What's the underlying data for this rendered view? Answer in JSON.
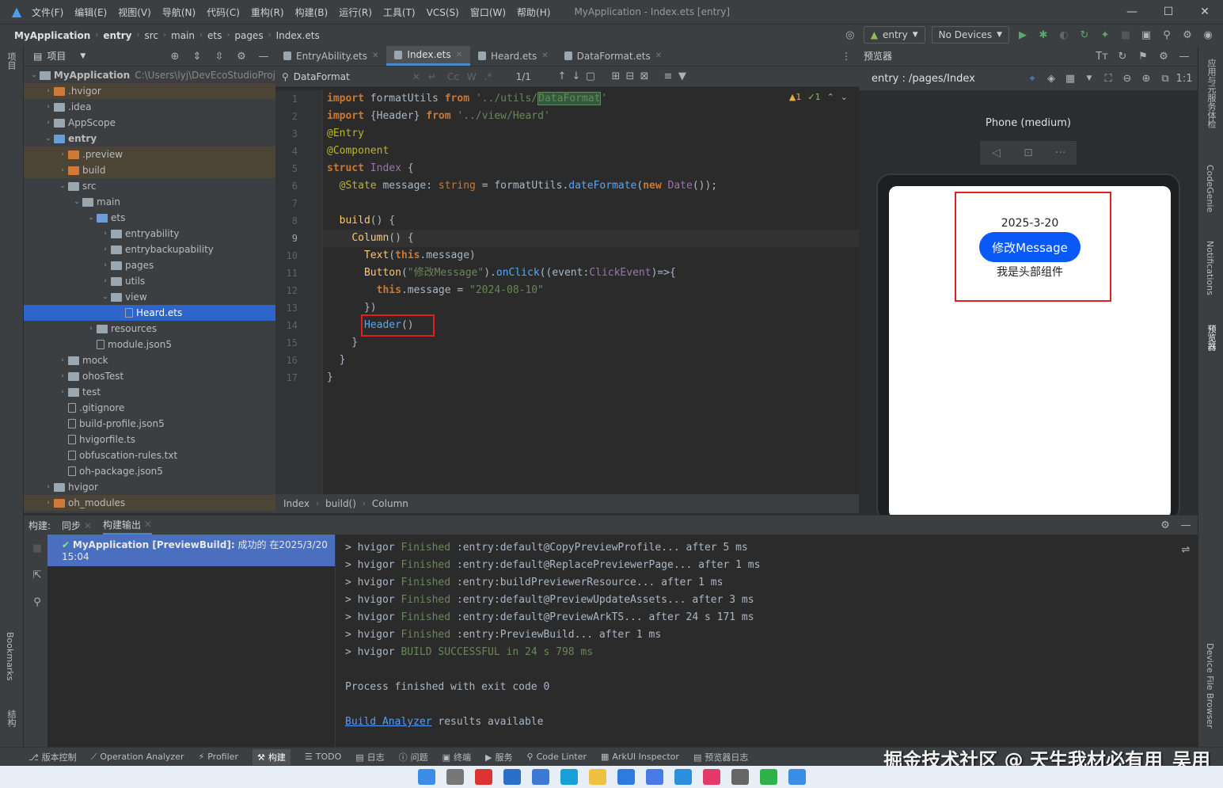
{
  "titlebar": {
    "menus": [
      "文件(F)",
      "编辑(E)",
      "视图(V)",
      "导航(N)",
      "代码(C)",
      "重构(R)",
      "构建(B)",
      "运行(R)",
      "工具(T)",
      "VCS(S)",
      "窗口(W)",
      "帮助(H)"
    ],
    "window_title": "MyApplication - Index.ets [entry]",
    "minimize": "—",
    "maximize": "☐",
    "close": "✕"
  },
  "navbar": {
    "crumbs": [
      "MyApplication",
      "entry",
      "src",
      "main",
      "ets",
      "pages",
      "Index.ets"
    ],
    "module_combo": "entry",
    "device_combo": "No Devices"
  },
  "left_strip": {
    "project_label": "项目",
    "bookmarks_label": "Bookmarks",
    "structure_label": "结构"
  },
  "project": {
    "title": "项目",
    "tree": [
      {
        "label": "MyApplication",
        "path": "C:\\Users\\lyj\\DevEcoStudioProj",
        "depth": 0,
        "arrow": "⌄",
        "icon": "gray",
        "bold": true
      },
      {
        "label": ".hvigor",
        "depth": 1,
        "arrow": "›",
        "icon": "orange",
        "hl": true
      },
      {
        "label": ".idea",
        "depth": 1,
        "arrow": "›",
        "icon": "gray"
      },
      {
        "label": "AppScope",
        "depth": 1,
        "arrow": "›",
        "icon": "gray"
      },
      {
        "label": "entry",
        "depth": 1,
        "arrow": "⌄",
        "icon": "blue",
        "bold": true
      },
      {
        "label": ".preview",
        "depth": 2,
        "arrow": "›",
        "icon": "orange",
        "hl": true
      },
      {
        "label": "build",
        "depth": 2,
        "arrow": "›",
        "icon": "orange",
        "hl": true
      },
      {
        "label": "src",
        "depth": 2,
        "arrow": "⌄",
        "icon": "gray"
      },
      {
        "label": "main",
        "depth": 3,
        "arrow": "⌄",
        "icon": "gray"
      },
      {
        "label": "ets",
        "depth": 4,
        "arrow": "⌄",
        "icon": "blue"
      },
      {
        "label": "entryability",
        "depth": 5,
        "arrow": "›",
        "icon": "gray"
      },
      {
        "label": "entrybackupability",
        "depth": 5,
        "arrow": "›",
        "icon": "gray"
      },
      {
        "label": "pages",
        "depth": 5,
        "arrow": "›",
        "icon": "gray"
      },
      {
        "label": "utils",
        "depth": 5,
        "arrow": "›",
        "icon": "gray"
      },
      {
        "label": "view",
        "depth": 5,
        "arrow": "⌄",
        "icon": "gray"
      },
      {
        "label": "Heard.ets",
        "depth": 6,
        "arrow": "",
        "icon": "file",
        "sel": true
      },
      {
        "label": "resources",
        "depth": 4,
        "arrow": "›",
        "icon": "gray"
      },
      {
        "label": "module.json5",
        "depth": 4,
        "arrow": "",
        "icon": "file"
      },
      {
        "label": "mock",
        "depth": 2,
        "arrow": "›",
        "icon": "gray"
      },
      {
        "label": "ohosTest",
        "depth": 2,
        "arrow": "›",
        "icon": "gray"
      },
      {
        "label": "test",
        "depth": 2,
        "arrow": "›",
        "icon": "gray"
      },
      {
        "label": ".gitignore",
        "depth": 2,
        "arrow": "",
        "icon": "file"
      },
      {
        "label": "build-profile.json5",
        "depth": 2,
        "arrow": "",
        "icon": "file"
      },
      {
        "label": "hvigorfile.ts",
        "depth": 2,
        "arrow": "",
        "icon": "file"
      },
      {
        "label": "obfuscation-rules.txt",
        "depth": 2,
        "arrow": "",
        "icon": "file"
      },
      {
        "label": "oh-package.json5",
        "depth": 2,
        "arrow": "",
        "icon": "file"
      },
      {
        "label": "hvigor",
        "depth": 1,
        "arrow": "›",
        "icon": "gray"
      },
      {
        "label": "oh_modules",
        "depth": 1,
        "arrow": "›",
        "icon": "orange",
        "hl": true
      }
    ]
  },
  "editor": {
    "tabs": [
      {
        "label": "EntryAbility.ets",
        "active": false
      },
      {
        "label": "Index.ets",
        "active": true
      },
      {
        "label": "Heard.ets",
        "active": false
      },
      {
        "label": "DataFormat.ets",
        "active": false
      }
    ],
    "find_query": "DataFormat",
    "find_count": "1/1",
    "warnings": "1",
    "weak_warnings": "1",
    "line_numbers": [
      "1",
      "2",
      "3",
      "4",
      "5",
      "6",
      "7",
      "8",
      "9",
      "10",
      "11",
      "12",
      "13",
      "14",
      "15",
      "16",
      "17"
    ],
    "footer": [
      "Index",
      "build()",
      "Column"
    ]
  },
  "preview": {
    "title": "预览器",
    "route": "entry : /pages/Index",
    "device": "Phone (medium)",
    "app_date": "2025-3-20",
    "app_button": "修改Message",
    "app_header": "我是头部组件"
  },
  "right_strip": [
    "应用与元服务体检",
    "CodeGenie",
    "Notifications",
    "预览器",
    "Device File Browser"
  ],
  "build": {
    "tabs": [
      "构建:",
      "同步",
      "构建输出"
    ],
    "task": "MyApplication [PreviewBuild]:",
    "task_status": "成功的 在2025/3/20 15:04",
    "output": [
      {
        "a": "> hvigor ",
        "b": "Finished",
        "c": " :entry:default@CopyPreviewProfile... after 5 ms"
      },
      {
        "a": "> hvigor ",
        "b": "Finished",
        "c": " :entry:default@ReplacePreviewerPage... after 1 ms"
      },
      {
        "a": "> hvigor ",
        "b": "Finished",
        "c": " :entry:buildPreviewerResource... after 1 ms"
      },
      {
        "a": "> hvigor ",
        "b": "Finished",
        "c": " :entry:default@PreviewUpdateAssets... after 3 ms"
      },
      {
        "a": "> hvigor ",
        "b": "Finished",
        "c": " :entry:default@PreviewArkTS... after 24 s 171 ms"
      },
      {
        "a": "> hvigor ",
        "b": "Finished",
        "c": " :entry:PreviewBuild... after 1 ms"
      },
      {
        "a": "> hvigor ",
        "b": "BUILD SUCCESSFUL in 24 s 798 ms",
        "c": ""
      }
    ],
    "process_exit": "Process finished with exit code 0",
    "analyzer_link": "Build Analyzer",
    "analyzer_text": " results available"
  },
  "statusbar": [
    "版本控制",
    "Operation Analyzer",
    "Profiler",
    "构建",
    "TODO",
    "日志",
    "问题",
    "终端",
    "服务",
    "Code Linter",
    "ArkUI Inspector",
    "预览器日志"
  ],
  "watermark": "掘金技术社区 @ 天生我材必有用_吴用"
}
